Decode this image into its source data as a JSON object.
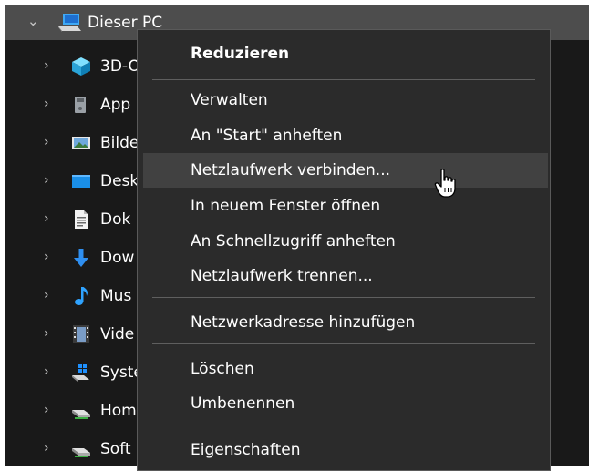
{
  "tree": {
    "root": {
      "label": "Dieser PC",
      "expanded": true
    },
    "items": [
      {
        "label": "3D-O",
        "icon": "3d-objects-icon"
      },
      {
        "label": "App",
        "icon": "apps-icon"
      },
      {
        "label": "Bilde",
        "icon": "pictures-icon"
      },
      {
        "label": "Desk",
        "icon": "desktop-icon"
      },
      {
        "label": "Dok",
        "icon": "documents-icon"
      },
      {
        "label": "Dow",
        "icon": "downloads-icon"
      },
      {
        "label": "Mus",
        "icon": "music-icon"
      },
      {
        "label": "Vide",
        "icon": "videos-icon"
      },
      {
        "label": "Syste",
        "icon": "system-drive-icon"
      },
      {
        "label": "Hom",
        "icon": "network-drive-icon"
      },
      {
        "label": "Soft",
        "icon": "network-drive-icon"
      }
    ]
  },
  "context_menu": {
    "hovered": "map_drive",
    "items": {
      "collapse": "Reduzieren",
      "manage": "Verwalten",
      "pin_start": "An \"Start\" anheften",
      "map_drive": "Netzlaufwerk verbinden...",
      "open_new_window": "In neuem Fenster öffnen",
      "pin_quick": "An Schnellzugriff anheften",
      "disconnect_drive": "Netzlaufwerk trennen...",
      "add_network_location": "Netzwerkadresse hinzufügen",
      "delete": "Löschen",
      "rename": "Umbenennen",
      "properties": "Eigenschaften"
    }
  },
  "colors": {
    "menu_bg": "#2b2b2b",
    "menu_hover": "#414141",
    "tree_bg": "#191919",
    "selected_row": "#4d4d4d"
  }
}
